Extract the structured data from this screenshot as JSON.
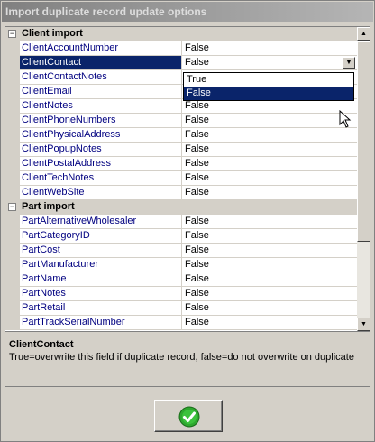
{
  "window": {
    "title": "Import duplicate record update options"
  },
  "grid": {
    "dropdown_arrow_icon": "chevron-down-icon",
    "categories": [
      {
        "label": "Client import",
        "toggle": "−",
        "items": [
          {
            "name": "ClientAccountNumber",
            "value": "False"
          },
          {
            "name": "ClientContact",
            "value": "False"
          },
          {
            "name": "ClientContactNotes",
            "value": ""
          },
          {
            "name": "ClientEmail",
            "value": ""
          },
          {
            "name": "ClientNotes",
            "value": "False"
          },
          {
            "name": "ClientPhoneNumbers",
            "value": "False"
          },
          {
            "name": "ClientPhysicalAddress",
            "value": "False"
          },
          {
            "name": "ClientPopupNotes",
            "value": "False"
          },
          {
            "name": "ClientPostalAddress",
            "value": "False"
          },
          {
            "name": "ClientTechNotes",
            "value": "False"
          },
          {
            "name": "ClientWebSite",
            "value": "False"
          }
        ]
      },
      {
        "label": "Part import",
        "toggle": "−",
        "items": [
          {
            "name": "PartAlternativeWholesaler",
            "value": "False"
          },
          {
            "name": "PartCategoryID",
            "value": "False"
          },
          {
            "name": "PartCost",
            "value": "False"
          },
          {
            "name": "PartManufacturer",
            "value": "False"
          },
          {
            "name": "PartName",
            "value": "False"
          },
          {
            "name": "PartNotes",
            "value": "False"
          },
          {
            "name": "PartRetail",
            "value": "False"
          },
          {
            "name": "PartTrackSerialNumber",
            "value": "False"
          }
        ]
      }
    ],
    "dropdown_options": [
      "True",
      "False"
    ],
    "selected_option": "False",
    "scroll_up_icon": "triangle-up-icon",
    "scroll_down_icon": "triangle-down-icon"
  },
  "description": {
    "title": "ClientContact",
    "text": "True=overwrite this field if duplicate record, false=do not overwrite on duplicate"
  },
  "ok_button": {
    "icon": "green-check-icon",
    "accent": "#2ea82e"
  }
}
